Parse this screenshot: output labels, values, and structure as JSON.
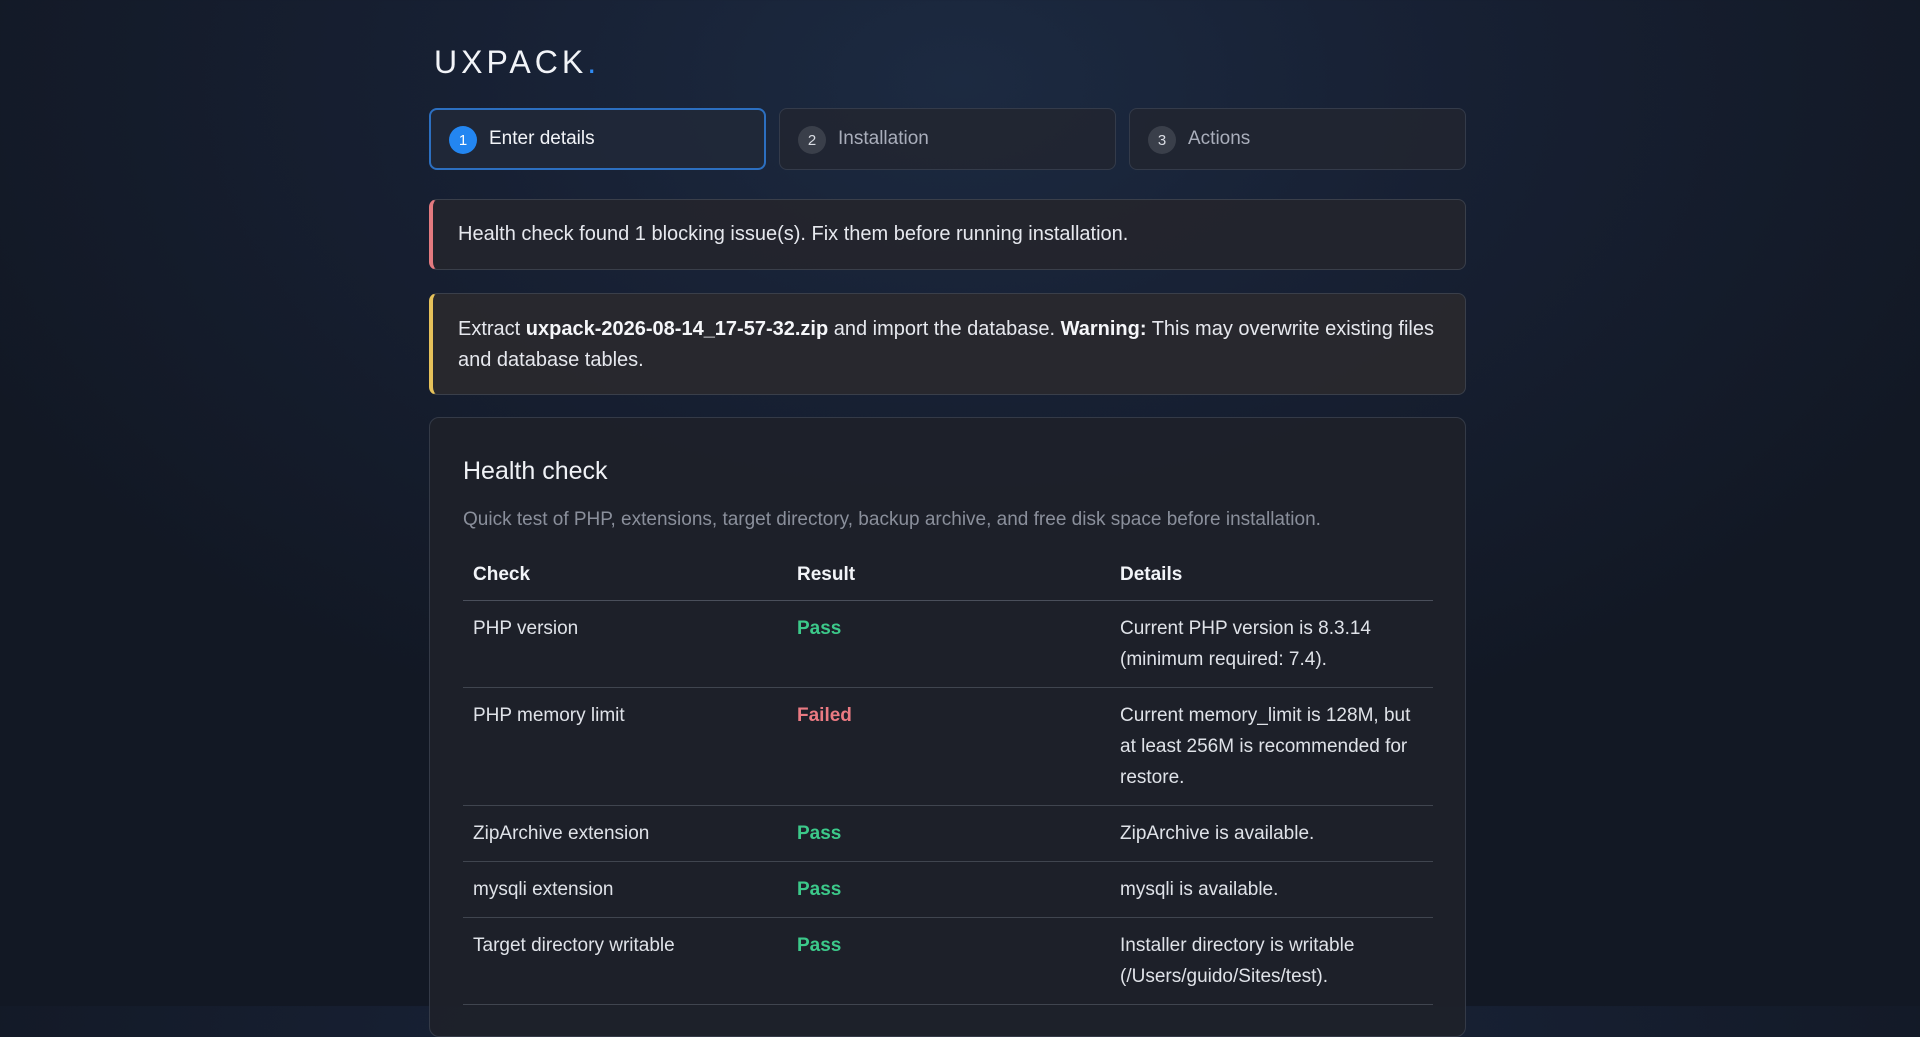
{
  "brand": {
    "name": "UXPACK",
    "dot": "."
  },
  "steps": [
    {
      "number": "1",
      "label": "Enter details",
      "active": true
    },
    {
      "number": "2",
      "label": "Installation",
      "active": false
    },
    {
      "number": "3",
      "label": "Actions",
      "active": false
    }
  ],
  "alerts": {
    "error": {
      "text": "Health check found 1 blocking issue(s). Fix them before running installation.",
      "color": "#e37a7f"
    },
    "warning": {
      "prefix": "Extract ",
      "filename": "uxpack-2026-08-14_17-57-32.zip",
      "middle": " and import the database. ",
      "warning_label": "Warning:",
      "suffix": " This may overwrite existing files and database tables.",
      "color": "#e5c15a"
    }
  },
  "health_check": {
    "title": "Health check",
    "description": "Quick test of PHP, extensions, target directory, backup archive, and free disk space before installation.",
    "columns": [
      "Check",
      "Result",
      "Details"
    ],
    "rows": [
      {
        "check": "PHP version",
        "result": "Pass",
        "details": "Current PHP version is 8.3.14 (minimum required: 7.4)."
      },
      {
        "check": "PHP memory limit",
        "result": "Failed",
        "details": "Current memory_limit is 128M, but at least 256M is recommended for restore."
      },
      {
        "check": "ZipArchive extension",
        "result": "Pass",
        "details": "ZipArchive is available."
      },
      {
        "check": "mysqli extension",
        "result": "Pass",
        "details": "mysqli is available."
      },
      {
        "check": "Target directory writable",
        "result": "Pass",
        "details": "Installer directory is writable (/Users/guido/Sites/test)."
      }
    ]
  },
  "colors": {
    "accent": "#2386f1",
    "pass": "#3cc98a",
    "fail": "#ea7a82"
  }
}
